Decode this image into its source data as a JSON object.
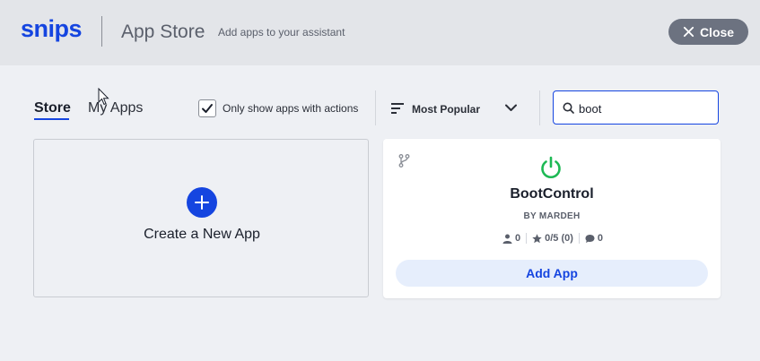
{
  "header": {
    "logo": "snips",
    "title": "App Store",
    "subtitle": "Add apps to your assistant",
    "close_label": "Close",
    "close_icon": "x-icon"
  },
  "tabs": [
    {
      "label": "Store",
      "active": true
    },
    {
      "label": "My Apps",
      "active": false
    }
  ],
  "filters": {
    "only_actions_label": "Only show apps with actions",
    "only_actions_checked": true,
    "sort_label": "Most Popular",
    "sort_icon": "sort-icon",
    "search_value": "boot",
    "search_icon": "search-icon"
  },
  "create_card": {
    "label": "Create a New App",
    "icon": "plus-icon"
  },
  "apps": [
    {
      "name": "BootControl",
      "author": "BY MARDEH",
      "icon": "power-icon",
      "fork_icon": "fork-icon",
      "users": "0",
      "rating": "0/5 (0)",
      "comments": "0",
      "add_label": "Add App"
    }
  ],
  "colors": {
    "brand": "#1545e0",
    "power_green": "#1db954",
    "close_bg": "#6c7280",
    "add_bg": "#e6eefc"
  }
}
